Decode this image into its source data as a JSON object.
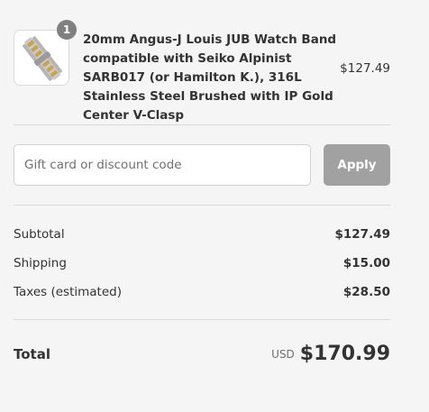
{
  "cart": {
    "item": {
      "quantity": "1",
      "name": "20mm Angus-J Louis JUB Watch Band compatible with Seiko Alpinist SARB017 (or Hamilton K.), 316L Stainless Steel Brushed with IP Gold Center V-Clasp",
      "price": "$127.49",
      "image_icon": "watch-band-thumbnail"
    }
  },
  "discount": {
    "placeholder": "Gift card or discount code",
    "value": "",
    "apply_label": "Apply"
  },
  "summary": {
    "subtotal_label": "Subtotal",
    "subtotal_value": "$127.49",
    "shipping_label": "Shipping",
    "shipping_value": "$15.00",
    "taxes_label": "Taxes (estimated)",
    "taxes_value": "$28.50"
  },
  "total": {
    "label": "Total",
    "currency": "USD",
    "amount": "$170.99"
  },
  "colors": {
    "background": "#f5f5f5",
    "badge": "#808080",
    "apply_button_disabled": "#a1a1a1",
    "text": "#333333"
  }
}
